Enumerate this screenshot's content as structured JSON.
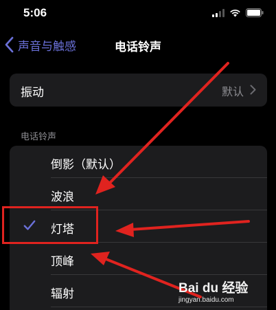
{
  "status_bar": {
    "time": "5:06"
  },
  "nav": {
    "back_label": "声音与触感",
    "title": "电话铃声"
  },
  "vibration": {
    "label": "振动",
    "value": "默认"
  },
  "ringtones": {
    "section_header": "电话铃声",
    "selected_index": 2,
    "items": [
      {
        "label": "倒影（默认）",
        "selected": false
      },
      {
        "label": "波浪",
        "selected": false
      },
      {
        "label": "灯塔",
        "selected": true
      },
      {
        "label": "顶峰",
        "selected": false
      },
      {
        "label": "辐射",
        "selected": false
      }
    ]
  },
  "colors": {
    "accent": "#6a70d8",
    "annotation": "#e0231f",
    "cell_background": "#1c1c1e",
    "secondary_text": "#8d8d92"
  },
  "watermark": {
    "brand": "Bai du 经验",
    "url": "jingyan.baidu.com"
  }
}
